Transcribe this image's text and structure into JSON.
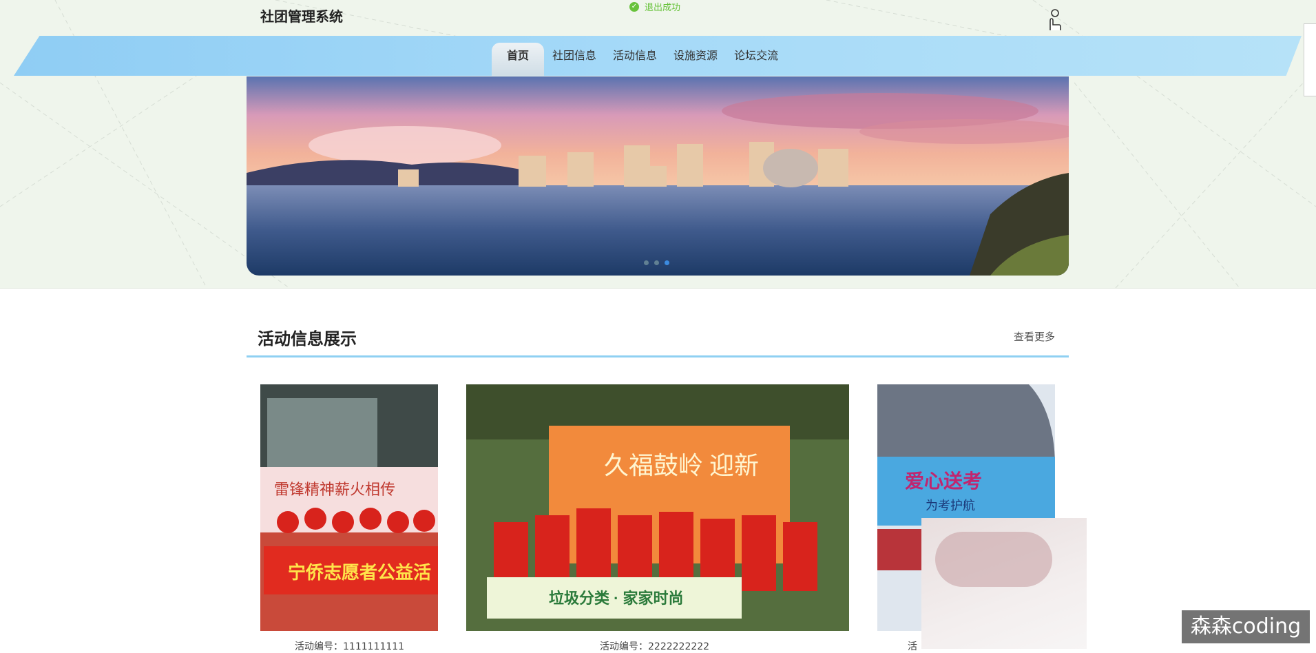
{
  "app": {
    "title": "社团管理系统"
  },
  "toast": {
    "text": "退出成功"
  },
  "nav": {
    "items": [
      {
        "label": "首页",
        "active": true
      },
      {
        "label": "社团信息"
      },
      {
        "label": "活动信息"
      },
      {
        "label": "设施资源"
      },
      {
        "label": "论坛交流"
      }
    ]
  },
  "carousel": {
    "active_index": 2,
    "count": 3
  },
  "section": {
    "title": "活动信息展示",
    "more": "查看更多"
  },
  "activities": [
    {
      "caption": "活动编号：1111111111",
      "banner_text": "宁侨志愿者公益活",
      "top_text": "雷锋精神薪火相传"
    },
    {
      "caption": "活动编号：2222222222",
      "banner_text": "垃圾分类 · 家家时尚",
      "top_text": "久福鼓岭 迎新"
    },
    {
      "caption": "活",
      "banner_text": "爱心送考",
      "top_text": "为考护航"
    }
  ],
  "watermark": {
    "text": "森森coding"
  },
  "colors": {
    "accent": "#8fcdf4",
    "toast": "#67c23a",
    "underline": "#8fd0f2"
  }
}
